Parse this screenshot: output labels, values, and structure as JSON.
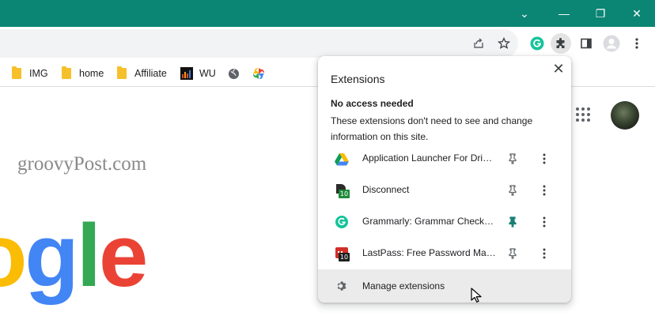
{
  "window": {
    "chevron_glyph": "⌄",
    "minimize_glyph": "—",
    "restore_glyph": "❐",
    "close_glyph": "✕",
    "accent_color": "#0b8574"
  },
  "bookmarks": [
    {
      "label": "IMG",
      "icon": "folder-icon"
    },
    {
      "label": "home",
      "icon": "folder-icon"
    },
    {
      "label": "Affiliate",
      "icon": "folder-icon"
    },
    {
      "label": "WU",
      "icon": "wu-favicon"
    }
  ],
  "page": {
    "watermark": "groovyPost.com",
    "logo_letters": [
      "o",
      "g",
      "l",
      "e"
    ],
    "logo_colors": [
      "#fbbc05",
      "#4285f4",
      "#34a853",
      "#ea4335"
    ]
  },
  "extensions_popup": {
    "title": "Extensions",
    "close_glyph": "✕",
    "section_heading": "No access needed",
    "section_description": "These extensions don't need to see and change information on this site.",
    "items": [
      {
        "name": "Application Launcher For Drive (by Google)",
        "icon": "google-drive-icon",
        "pinned": false
      },
      {
        "name": "Disconnect",
        "icon": "disconnect-icon",
        "badge": "10",
        "pinned": false
      },
      {
        "name": "Grammarly: Grammar Checker and Writing App",
        "icon": "grammarly-icon",
        "pinned": true
      },
      {
        "name": "LastPass: Free Password Manager",
        "icon": "lastpass-icon",
        "badge": "10",
        "pinned": false
      }
    ],
    "manage_label": "Manage extensions",
    "pinned_color": "#1a7f73"
  }
}
